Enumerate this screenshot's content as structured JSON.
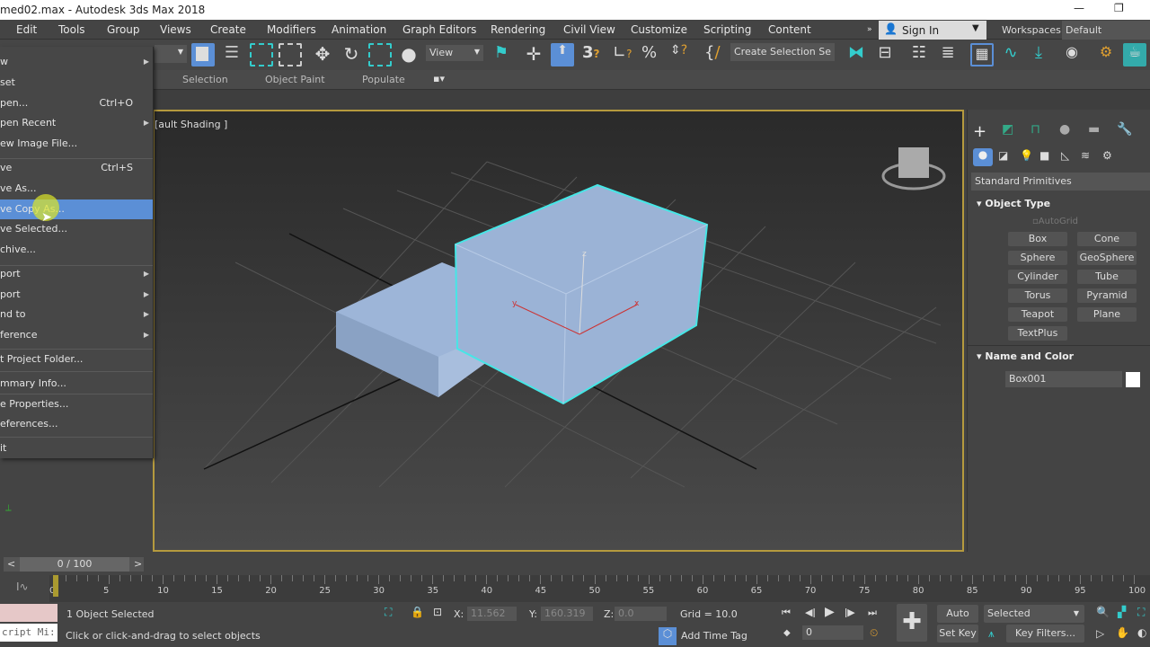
{
  "window": {
    "title": "med02.max - Autodesk 3ds Max 2018",
    "minimize": "—",
    "restore": "❐"
  },
  "menubar": {
    "items": [
      "Edit",
      "Tools",
      "Group",
      "Views",
      "Create",
      "Modifiers",
      "Animation",
      "Graph Editors",
      "Rendering",
      "Civil View",
      "Customize",
      "Scripting",
      "Content"
    ],
    "overflow": "»",
    "sign_in": "Sign In",
    "workspaces_label": "Workspaces:",
    "workspace_value": "Default"
  },
  "toolbar": {
    "view_dropdown": "View",
    "selection_set": "Create Selection Se"
  },
  "ribbon": {
    "tabs": [
      "Selection",
      "Object Paint",
      "Populate"
    ]
  },
  "viewport": {
    "label": "[ault Shading ]",
    "axis_x": "x",
    "axis_y": "y",
    "axis_z": "z"
  },
  "file_menu": {
    "items": [
      {
        "label": "w",
        "shortcut": "",
        "submenu": true
      },
      {
        "label": "set",
        "shortcut": "",
        "submenu": false
      },
      {
        "label": "pen...",
        "shortcut": "Ctrl+O",
        "submenu": false
      },
      {
        "label": "pen Recent",
        "shortcut": "",
        "submenu": true
      },
      {
        "label": "ew Image File...",
        "shortcut": "",
        "submenu": false
      },
      {
        "label": "ve",
        "shortcut": "Ctrl+S",
        "submenu": false
      },
      {
        "label": "ve As...",
        "shortcut": "",
        "submenu": false
      },
      {
        "label": "ve Copy As...",
        "shortcut": "",
        "submenu": false
      },
      {
        "label": "ve Selected...",
        "shortcut": "",
        "submenu": false
      },
      {
        "label": "chive...",
        "shortcut": "",
        "submenu": false
      },
      {
        "label": "port",
        "shortcut": "",
        "submenu": true
      },
      {
        "label": "port",
        "shortcut": "",
        "submenu": true
      },
      {
        "label": "nd to",
        "shortcut": "",
        "submenu": true
      },
      {
        "label": "ference",
        "shortcut": "",
        "submenu": true
      },
      {
        "label": "t Project Folder...",
        "shortcut": "",
        "submenu": false
      },
      {
        "label": "mmary Info...",
        "shortcut": "",
        "submenu": false
      },
      {
        "label": "e Properties...",
        "shortcut": "",
        "submenu": false
      },
      {
        "label": "eferences...",
        "shortcut": "",
        "submenu": false
      },
      {
        "label": "it",
        "shortcut": "",
        "submenu": false
      }
    ],
    "highlighted_index": 7
  },
  "command_panel": {
    "category": "Standard Primitives",
    "object_type_title": "Object Type",
    "autogrid": "AutoGrid",
    "primitives": [
      "Box",
      "Cone",
      "Sphere",
      "GeoSphere",
      "Cylinder",
      "Tube",
      "Torus",
      "Pyramid",
      "Teapot",
      "Plane",
      "TextPlus"
    ],
    "name_color_title": "Name and Color",
    "object_name": "Box001",
    "object_color": "#ffffff"
  },
  "timeline": {
    "frame_display": "0 / 100",
    "prev": "<",
    "next": ">",
    "ticks": [
      "0",
      "5",
      "10",
      "15",
      "20",
      "25",
      "30",
      "35",
      "40",
      "45",
      "50",
      "55",
      "60",
      "65",
      "70",
      "75",
      "80",
      "85",
      "90",
      "95",
      "100"
    ],
    "current_frame": 0,
    "total_frames": 100
  },
  "status": {
    "selected": "1 Object Selected",
    "prompt": "Click or click-and-drag to select objects",
    "maxscript": "cript Mi:",
    "x_label": "X:",
    "x_value": "11.562",
    "y_label": "Y:",
    "y_value": "160.319",
    "z_label": "Z:",
    "z_value": "0.0",
    "grid": "Grid = 10.0",
    "add_time_tag": "Add Time Tag",
    "frame_spinner": "0",
    "auto_key": "Auto Key",
    "set_key": "Set Key",
    "key_mode": "Selected",
    "key_filters": "Key Filters..."
  },
  "colors": {
    "accent": "#5b8fd6",
    "selection": "#46e6e6",
    "viewport_border": "#b59a3e",
    "box": "#9bb3d6"
  }
}
